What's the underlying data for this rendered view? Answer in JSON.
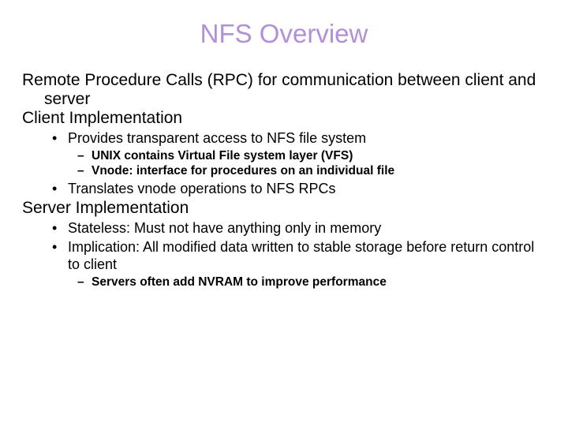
{
  "title": "NFS Overview",
  "p1": "Remote Procedure Calls (RPC) for communication between client and server",
  "p2": "Client Implementation",
  "client": {
    "b1": "Provides transparent access to NFS file system",
    "b1_sub1": "UNIX contains Virtual File system layer (VFS)",
    "b1_sub2": "Vnode: interface for procedures on an individual file",
    "b2": "Translates vnode operations to NFS RPCs"
  },
  "p3": "Server Implementation",
  "server": {
    "b1": "Stateless: Must not have anything only in memory",
    "b2": "Implication: All modified data written to stable storage before return control to client",
    "b2_sub1": "Servers often add NVRAM to improve performance"
  }
}
